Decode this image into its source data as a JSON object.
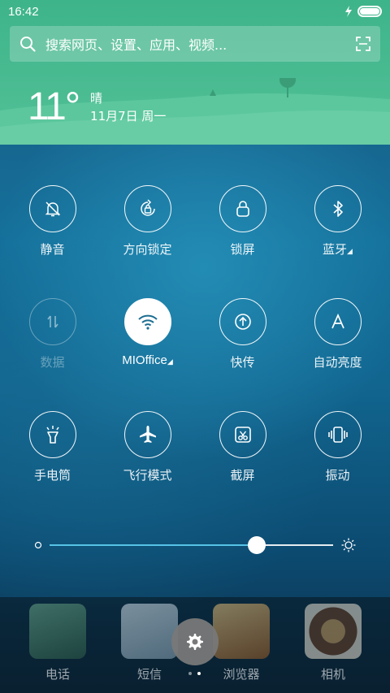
{
  "status_bar": {
    "time": "16:42"
  },
  "search": {
    "placeholder": "搜索网页、设置、应用、视频..."
  },
  "weather": {
    "temperature": "11°",
    "condition": "晴",
    "date": "11月7日 周一"
  },
  "toggles": [
    {
      "label": "静音",
      "icon": "mute-bell-icon",
      "state": "off"
    },
    {
      "label": "方向锁定",
      "icon": "rotation-lock-icon",
      "state": "off"
    },
    {
      "label": "锁屏",
      "icon": "lock-icon",
      "state": "off"
    },
    {
      "label": "蓝牙",
      "icon": "bluetooth-icon",
      "state": "off"
    },
    {
      "label": "数据",
      "icon": "data-arrows-icon",
      "state": "disabled"
    },
    {
      "label": "MIOffice",
      "icon": "wifi-icon",
      "state": "on"
    },
    {
      "label": "快传",
      "icon": "transfer-icon",
      "state": "off"
    },
    {
      "label": "自动亮度",
      "icon": "auto-brightness-icon",
      "state": "off"
    },
    {
      "label": "手电筒",
      "icon": "flashlight-icon",
      "state": "off"
    },
    {
      "label": "飞行模式",
      "icon": "airplane-icon",
      "state": "off"
    },
    {
      "label": "截屏",
      "icon": "screenshot-icon",
      "state": "off"
    },
    {
      "label": "振动",
      "icon": "vibrate-icon",
      "state": "off"
    }
  ],
  "brightness": {
    "level": 0.73
  },
  "dock": [
    {
      "label": "电话",
      "color": "#3f7a60"
    },
    {
      "label": "短信",
      "color": "#9fb6c4"
    },
    {
      "label": "浏览器",
      "color": "#c58a3a"
    },
    {
      "label": "相机",
      "color": "#7a4a2e"
    }
  ],
  "pager": {
    "current": 1,
    "total": 2
  },
  "colors": {
    "header": "#4cbb92",
    "accent": "#56c3e6"
  }
}
